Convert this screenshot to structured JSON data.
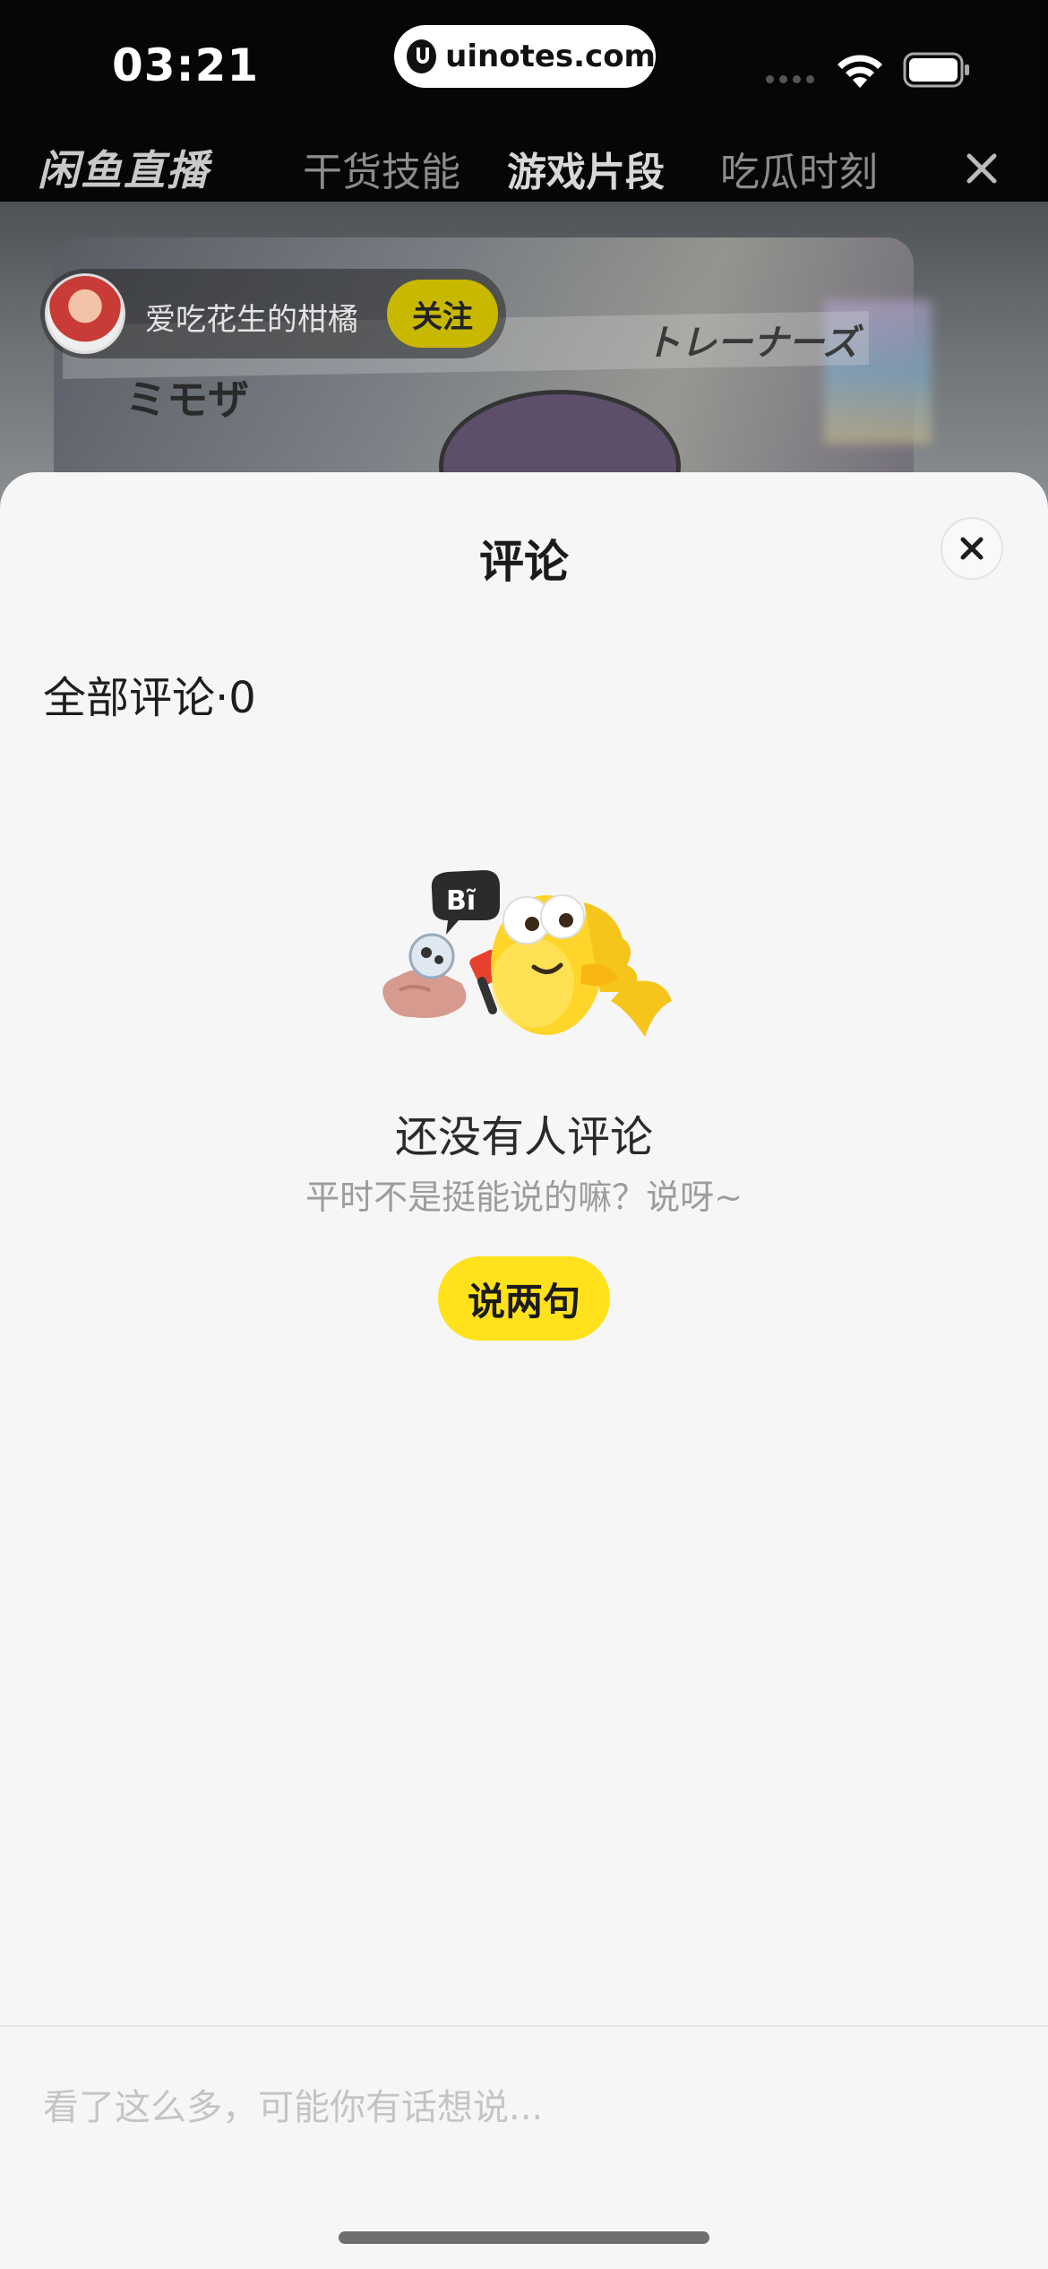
{
  "status_bar": {
    "time": "03:21",
    "url": "uinotes.com"
  },
  "top_nav": {
    "brand": "闲鱼直播",
    "tabs": [
      {
        "label": "干货技能",
        "active": false
      },
      {
        "label": "游戏片段",
        "active": true
      },
      {
        "label": "吃瓜时刻",
        "active": false
      }
    ]
  },
  "video": {
    "card_text_left": "ミモザ",
    "card_text_right": "トレーナーズ",
    "streamer_name": "爱吃花生的柑橘",
    "follow_label": "关注"
  },
  "comments_sheet": {
    "title": "评论",
    "count_label": "全部评论·0",
    "empty_title": "还没有人评论",
    "empty_subtitle": "平时不是挺能说的嘛？说呀~",
    "cta_label": "说两句",
    "input_placeholder": "看了这么多，可能你有话想说..."
  },
  "colors": {
    "accent_yellow": "#ffe21c",
    "follow_yellow": "#c8b800",
    "sheet_bg": "#f6f6f6"
  }
}
